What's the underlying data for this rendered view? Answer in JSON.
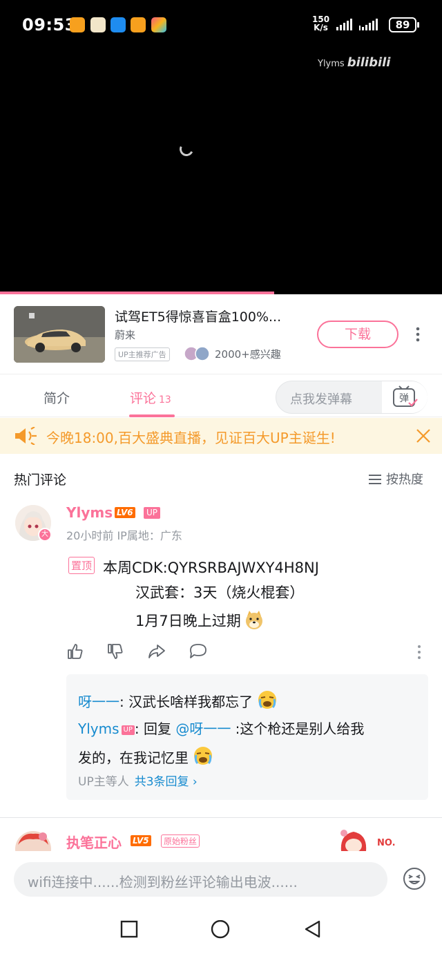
{
  "status_bar": {
    "time": "09:53",
    "net_speed_value": "150",
    "net_speed_unit": "K/s",
    "battery": "89"
  },
  "video": {
    "watermark_user": "Ylyms",
    "watermark_brand": "bilibili",
    "progress_fraction": 0.62
  },
  "ad": {
    "title": "试驾ET5得惊喜盲盒100%...",
    "brand": "蔚来",
    "tag": "UP主推荐广告",
    "interest": "2000+感兴趣",
    "download_label": "下载"
  },
  "tabs": {
    "intro": "简介",
    "comments": "评论",
    "comments_count": "13",
    "danmaku_placeholder": "点我发弹幕",
    "danmaku_button": "弹"
  },
  "notice": {
    "text": "今晚18:00,百大盛典直播，见证百大UP主诞生!"
  },
  "comments_header": {
    "title": "热门评论",
    "sort_label": "按热度"
  },
  "comment": {
    "username": "Ylyms",
    "level": "LV6",
    "up_tag": "UP",
    "avatar_badge": "大",
    "meta": "20小时前  IP属地：广东",
    "pin_label": "置顶",
    "lines": [
      "本周CDK:QYRSRBAJWXY4H8NJ",
      "汉武套：3天（烧火棍套）",
      "1月7日晚上过期"
    ]
  },
  "replies": {
    "r1_name": "呀一一",
    "r1_text": ": 汉武长啥样我都忘了",
    "r2_name": "Ylyms",
    "r2_up": "UP",
    "r2_prefix": ": 回复 ",
    "r2_mention": "@呀一一",
    "r2_text": " :这个枪还是别人给我",
    "r2_text2": "发的，在我记忆里",
    "footer_who": "UP主等人",
    "footer_total": "共3条回复 ›"
  },
  "comment2": {
    "username": "执笔正心",
    "level": "LV5",
    "fan_badge": "原始粉丝",
    "deco_text": "NO."
  },
  "bottom": {
    "input_placeholder": "wifi连接中......检测到粉丝评论输出电波......"
  }
}
